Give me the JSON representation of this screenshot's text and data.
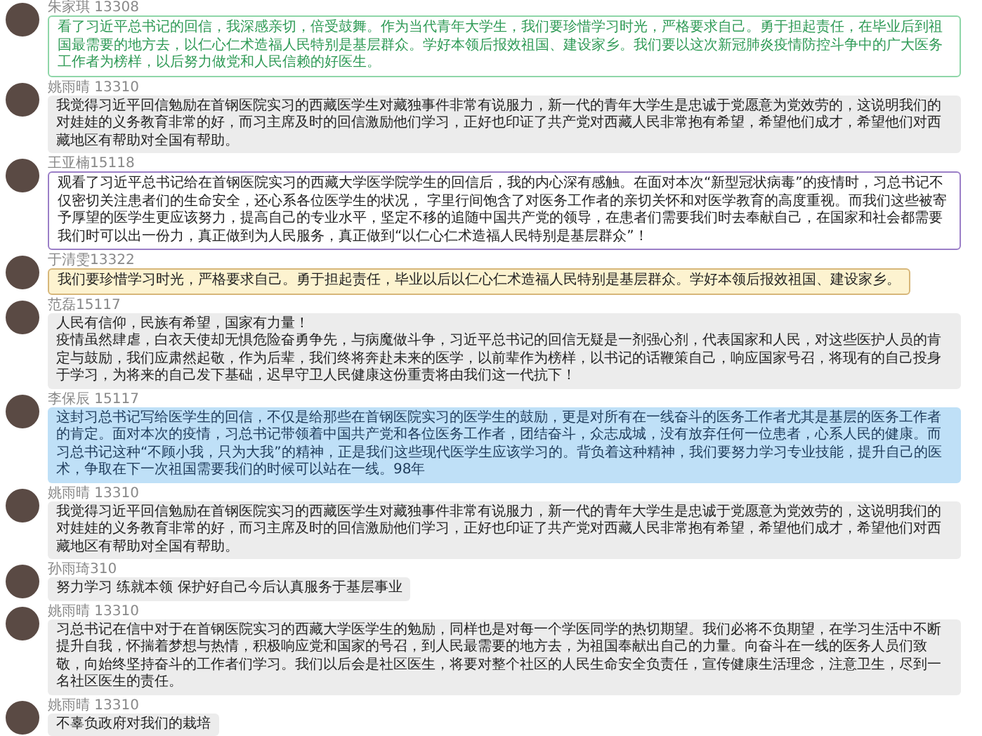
{
  "messages": [
    {
      "sender": "朱家琪 13308",
      "kind": "green",
      "text": "看了习近平总书记的回信，我深感亲切，倍受鼓舞。作为当代青年大学生，我们要珍惜学习时光，严格要求自己。勇于担起责任，在毕业后到祖国最需要的地方去，以仁心仁术造福人民特别是基层群众。学好本领后报效祖国、建设家乡。我们要以这次新冠肺炎疫情防控斗争中的广大医务工作者为榜样，以后努力做党和人民信赖的好医生。"
    },
    {
      "sender": "姚雨晴 13310",
      "kind": "gray",
      "text": "我觉得习近平回信勉励在首钢医院实习的西藏医学生对藏独事件非常有说服力，新一代的青年大学生是忠诚于党愿意为党效劳的，这说明我们的对娃娃的义务教育非常的好，而习主席及时的回信激励他们学习，正好也印证了共产党对西藏人民非常抱有希望，希望他们成才，希望他们对西藏地区有帮助对全国有帮助。"
    },
    {
      "sender": "王亚楠15118",
      "kind": "purple",
      "text": "观看了习近平总书记给在首钢医院实习的西藏大学医学院学生的回信后，我的内心深有感触。在面对本次“新型冠状病毒”的疫情时，习总书记不仅密切关注患者们的生命安全，还心系各位医学生的状况， 字里行间饱含了对医务工作者的亲切关怀和对医学教育的高度重视。而我们这些被寄予厚望的医学生更应该努力，提高自己的专业水平，坚定不移的追随中国共产党的领导，在患者们需要我们时去奉献自己，在国家和社会都需要我们时可以出一份力，真正做到为人民服务，真正做到“以仁心仁术造福人民特别是基层群众”！"
    },
    {
      "sender": "于清雯13322",
      "kind": "yellow",
      "text": "我们要珍惜学习时光，严格要求自己。勇于担起责任，毕业以后以仁心仁术造福人民特别是基层群众。学好本领后报效祖国、建设家乡。"
    },
    {
      "sender": "范磊15117",
      "kind": "gray",
      "text": "人民有信仰，民族有希望，国家有力量！",
      "text_2": "疫情虽然肆虐，白衣天使却无惧危险奋勇争先，与病魔做斗争，习近平总书记的回信无疑是一剂强心剂，代表国家和人民，对这些医护人员的肯定与鼓励，我们应肃然起敬，作为后辈，我们终将奔赴未来的医学，以前辈作为榜样，以书记的话鞭策自己，响应国家号召，将现有的自己投身于学习，为将来的自己发下基础，迟早守卫人民健康这份重责将由我们这一代抗下！"
    },
    {
      "sender": "李保辰 15117",
      "kind": "blue",
      "text": "这封习总书记写给医学生的回信，不仅是给那些在首钢医院实习的医学生的鼓励，更是对所有在一线奋斗的医务工作者尤其是基层的医务工作者的肯定。面对本次的疫情，习总书记带领着中国共产党和各位医务工作者，团结奋斗，众志成城，没有放弃任何一位患者，心系人民的健康。而习总书记这种“不顾小我，只为大我”的精神，正是我们这些现代医学生应该学习的。背负着这种精神，我们要努力学习专业技能，提升自己的医术，争取在下一次祖国需要我们的时候可以站在一线。98年"
    },
    {
      "sender": "姚雨晴 13310",
      "kind": "gray",
      "text": "我觉得习近平回信勉励在首钢医院实习的西藏医学生对藏独事件非常有说服力，新一代的青年大学生是忠诚于党愿意为党效劳的，这说明我们的对娃娃的义务教育非常的好，而习主席及时的回信激励他们学习，正好也印证了共产党对西藏人民非常抱有希望，希望他们成才，希望他们对西藏地区有帮助对全国有帮助。"
    },
    {
      "sender": "孙雨琦310",
      "kind": "gray",
      "text": "努力学习 练就本领 保护好自己今后认真服务于基层事业"
    },
    {
      "sender": "姚雨晴 13310",
      "kind": "gray",
      "text": "习总书记在信中对于在首钢医院实习的西藏大学医学生的勉励，同样也是对每一个学医同学的热切期望。我们必将不负期望，在学习生活中不断提升自我，怀揣着梦想与热情，积极响应党和国家的号召，到人民最需要的地方去，为祖国奉献出自己的力量。向奋斗在一线的医务人员们致敬，向始终坚持奋斗的工作者们学习。我们以后会是社区医生，将要对整个社区的人民生命安全负责任，宣传健康生活理念，注意卫生，尽到一名社区医生的责任。"
    },
    {
      "sender": "姚雨晴 13310",
      "kind": "gray",
      "text": "不辜负政府对我们的栽培"
    }
  ]
}
